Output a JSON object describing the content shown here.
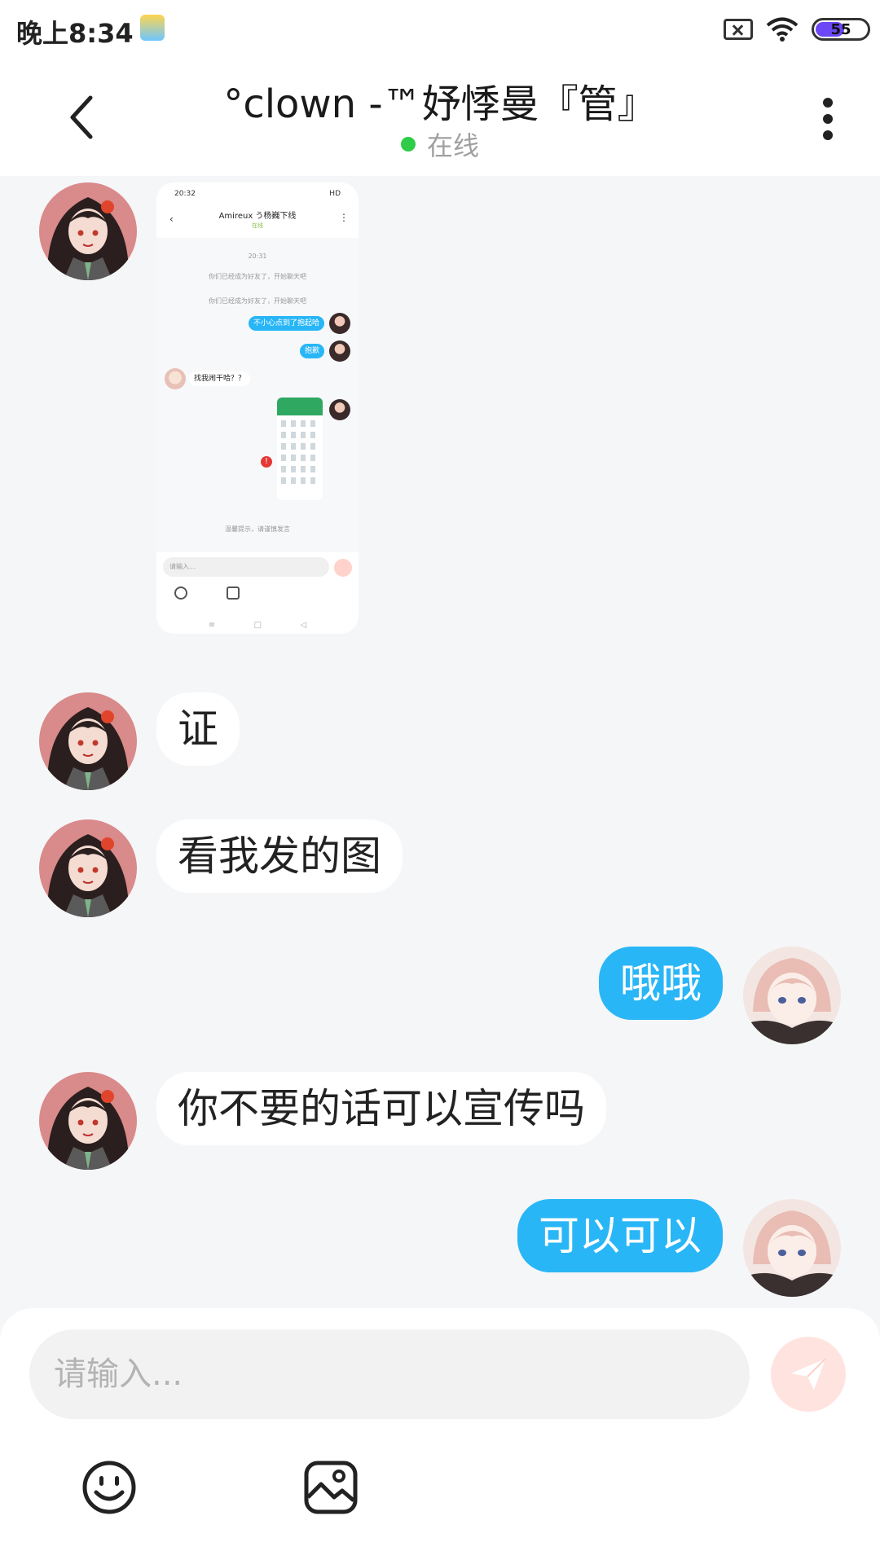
{
  "status_bar": {
    "time": "晚上8:34",
    "battery": "55",
    "battery_level_percent": 55
  },
  "header": {
    "title": "°clown -™妤悸曼『管』",
    "status": "在线",
    "status_color": "#2ecc48"
  },
  "thumbnail": {
    "status_time": "20:32",
    "status_right": "HD",
    "title": "Amireux う杨巍下线",
    "online": "在线",
    "time": "20:31",
    "system_1": "你们已经成为好友了，开始聊天吧",
    "system_2": "你们已经成为好友了，开始聊天吧",
    "out_1": "不小心点到了抱起哈",
    "out_2": "抱歉",
    "in_1": "找我闹干哈？？",
    "tip": "温馨提示，请谨慎发言",
    "input_placeholder": "请输入..."
  },
  "messages": [
    {
      "dir": "in",
      "text": "证"
    },
    {
      "dir": "in",
      "text": "看我发的图"
    },
    {
      "dir": "out",
      "text": "哦哦"
    },
    {
      "dir": "in",
      "text": "你不要的话可以宣传吗"
    },
    {
      "dir": "out",
      "text": "可以可以"
    }
  ],
  "composer": {
    "placeholder": "请输入..."
  },
  "colors": {
    "outgoing_bubble": "#29b6f6",
    "incoming_bubble": "#ffffff",
    "send_button": "#ffe3df"
  }
}
